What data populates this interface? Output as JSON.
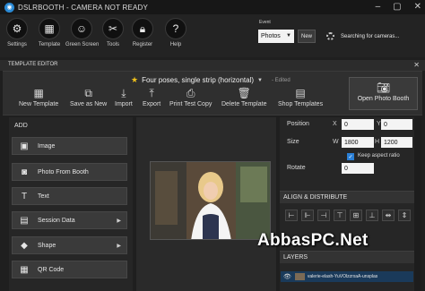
{
  "window": {
    "title": "DSLRBOOTH - CAMERA NOT READY"
  },
  "toolbar": {
    "items": [
      {
        "label": "Settings",
        "icon": "gear-icon"
      },
      {
        "label": "Template",
        "icon": "template-icon"
      },
      {
        "label": "Green Screen",
        "icon": "green-screen-icon"
      },
      {
        "label": "Tools",
        "icon": "tools-icon"
      },
      {
        "label": "Register",
        "icon": "lock-icon"
      },
      {
        "label": "Help",
        "icon": "help-icon"
      }
    ],
    "event_label": "Event",
    "event_value": "Photos",
    "new_label": "New",
    "camera_status": "Searching for cameras..."
  },
  "editor": {
    "title": "TEMPLATE EDITOR",
    "template_name": "Four poses, single strip (horizontal)",
    "edited_label": "- Edited",
    "ribbon": [
      {
        "label": "New Template",
        "icon": "new-template-icon"
      },
      {
        "label": "Save as New",
        "icon": "copy-icon"
      },
      {
        "label": "Import",
        "icon": "download-icon"
      },
      {
        "label": "Export",
        "icon": "upload-icon"
      },
      {
        "label": "Print Test Copy",
        "icon": "printer-icon"
      },
      {
        "label": "Delete Template",
        "icon": "trash-icon"
      },
      {
        "label": "Shop Templates",
        "icon": "shop-icon"
      }
    ],
    "open_booth_label": "Open Photo Booth"
  },
  "add_panel": {
    "title": "ADD",
    "items": [
      {
        "label": "Image",
        "icon": "image-icon",
        "submenu": false
      },
      {
        "label": "Photo From Booth",
        "icon": "camera-icon",
        "submenu": false
      },
      {
        "label": "Text",
        "icon": "text-icon",
        "submenu": false
      },
      {
        "label": "Session Data",
        "icon": "session-data-icon",
        "submenu": true
      },
      {
        "label": "Shape",
        "icon": "shape-icon",
        "submenu": true
      },
      {
        "label": "QR Code",
        "icon": "qr-code-icon",
        "submenu": false
      }
    ]
  },
  "properties": {
    "position_label": "Position",
    "x_label": "X",
    "x_value": "0",
    "y_label": "Y",
    "y_value": "0",
    "size_label": "Size",
    "w_label": "W",
    "w_value": "1800",
    "h_label": "H",
    "h_value": "1200",
    "keep_aspect_label": "Keep aspect ratio",
    "keep_aspect_checked": true,
    "rotate_label": "Rotate",
    "rotate_value": "0"
  },
  "align": {
    "title": "ALIGN & DISTRIBUTE"
  },
  "layers": {
    "title": "LAYERS",
    "items": [
      {
        "name": "valerie-elash-YuVOlzzrxaA-unsplas"
      }
    ]
  },
  "watermark": "AbbasPC.Net",
  "colors": {
    "accent": "#2a7fd6",
    "star": "#f1c21b",
    "background": "#1f1f1f"
  }
}
